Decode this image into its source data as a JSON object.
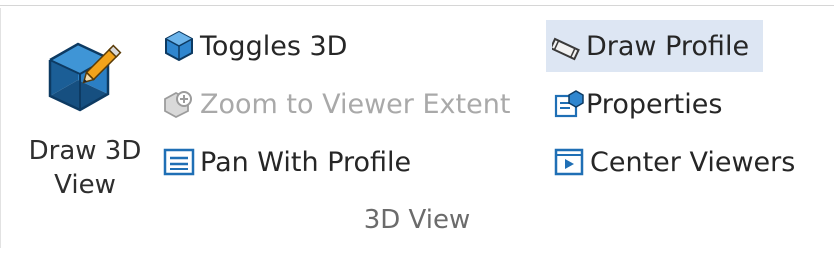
{
  "ribbon_group": {
    "label": "3D View",
    "big_button": {
      "label": "Draw 3D\nView",
      "icon": "draw-3d-view-icon"
    },
    "commands": [
      {
        "label": "Toggles 3D",
        "icon": "cube-icon",
        "enabled": true
      },
      {
        "label": "Zoom to Viewer Extent",
        "icon": "zoom-extent-icon",
        "enabled": false
      },
      {
        "label": "Pan With Profile",
        "icon": "pan-profile-icon",
        "enabled": true
      },
      {
        "label": "Draw Profile",
        "icon": "draw-profile-icon",
        "enabled": true,
        "highlighted": true
      },
      {
        "label": "Properties",
        "icon": "properties-icon",
        "enabled": true
      },
      {
        "label": "Center Viewers",
        "icon": "center-viewers-icon",
        "enabled": true
      }
    ]
  },
  "colors": {
    "icon_blue": "#1f78c8",
    "icon_dark": "#0d3a62",
    "highlight": "#dde6f3",
    "pencil": "#f2a31b"
  }
}
